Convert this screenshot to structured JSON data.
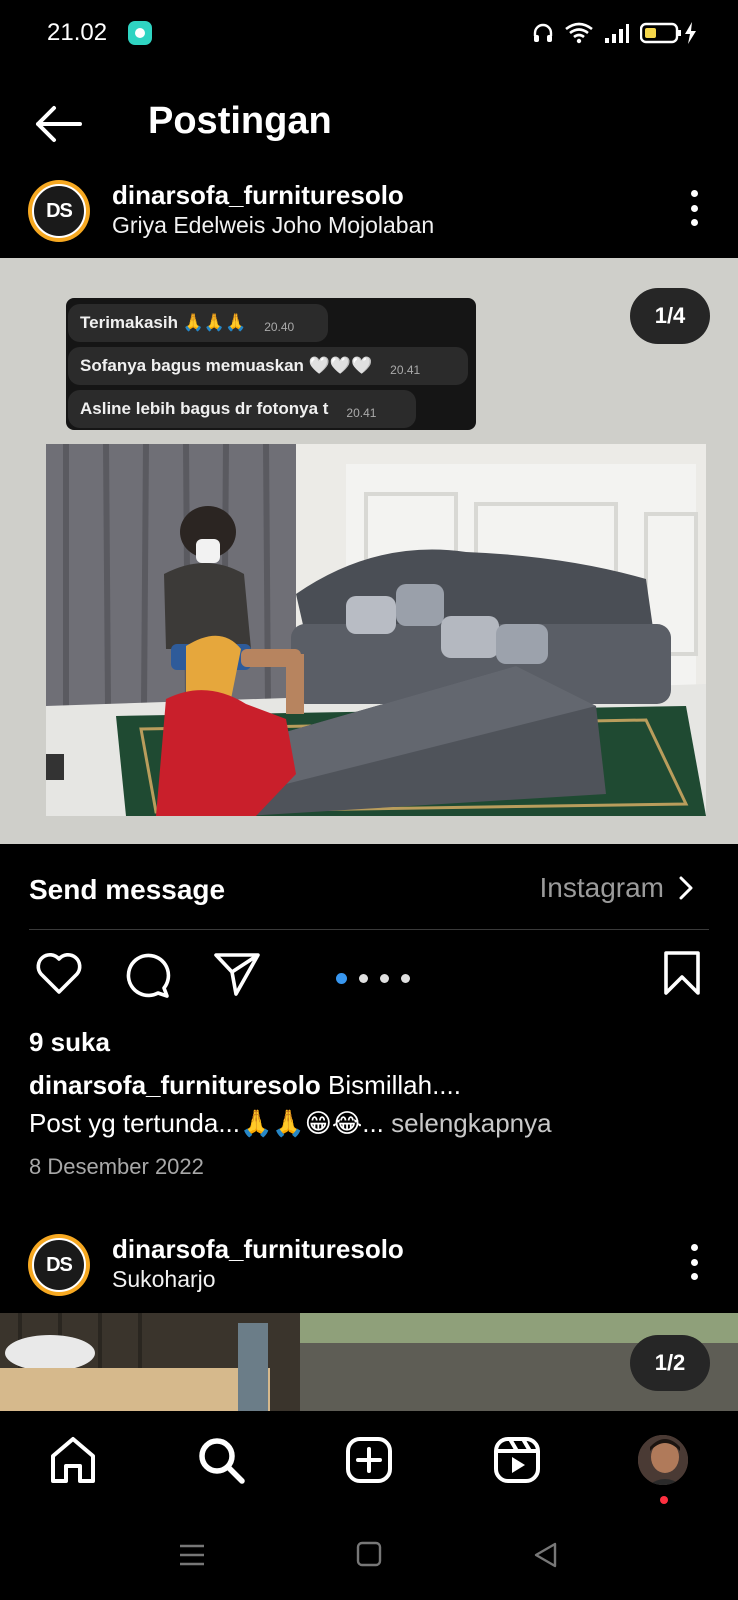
{
  "status_bar": {
    "time": "21.02"
  },
  "header": {
    "title": "Postingan"
  },
  "post": {
    "username": "dinarsofa_furnituresolo",
    "location": "Griya Edelweis Joho Mojolaban",
    "avatar_text": "DS",
    "image_counter": "1/4",
    "chat_messages": [
      {
        "text": "Terimakasih 🙏🙏🙏",
        "time": "20.40"
      },
      {
        "text": "Sofanya bagus memuaskan 🤍🤍🤍",
        "time": "20.41"
      },
      {
        "text": "Asline lebih bagus dr fotonya t",
        "time": "20.41"
      }
    ],
    "send_message_label": "Send message",
    "send_message_link": "Instagram",
    "likes": "9 suka",
    "caption_user": "dinarsofa_furnituresolo",
    "caption_line1": " Bismillah....",
    "caption_line2": "Post yg tertunda...🙏🙏😁😂...",
    "caption_more": " selengkapnya",
    "date": "8 Desember 2022"
  },
  "post2": {
    "username": "dinarsofa_furnituresolo",
    "location": "Sukoharjo",
    "avatar_text": "DS",
    "image_counter": "1/2"
  },
  "colors": {
    "accent": "#3897f0",
    "background": "#000000",
    "notification": "#ff3040"
  }
}
